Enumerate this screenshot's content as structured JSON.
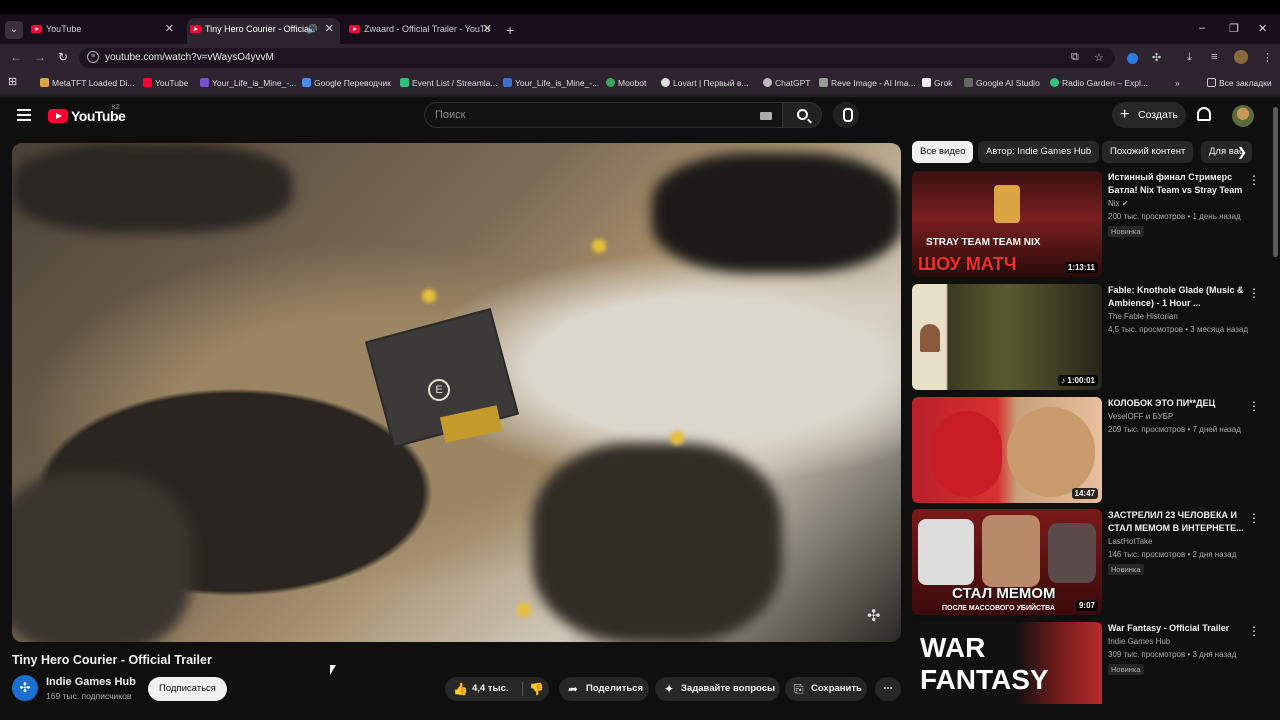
{
  "browser": {
    "tabs": [
      {
        "title": "YouTube"
      },
      {
        "title": "Tiny Hero Courier - Official"
      },
      {
        "title": "Zwaard - Official Trailer - YouTu"
      }
    ],
    "url": "youtube.com/watch?v=vWaysO4yvvM",
    "bookmarks": [
      "MetaTFT Loaded Di...",
      "YouTube",
      "Your_Life_is_Mine_-...",
      "Google Переводчик",
      "Event List / Streamla...",
      "Your_Life_is_Mine_-...",
      "Moobot",
      "Lovart | Первый в...",
      "ChatGPT",
      "Reve Image - AI Ima...",
      "Grok",
      "Google AI Studio",
      "Radio Garden – Expl..."
    ],
    "all_bookmarks": "Все закладки"
  },
  "header": {
    "logo_text": "YouTube",
    "region": "KZ",
    "search_placeholder": "Поиск",
    "create_label": "Создать"
  },
  "video": {
    "title": "Tiny Hero Courier - Official Trailer",
    "channel": "Indie Games Hub",
    "subscribers": "169 тыс. подписчиков",
    "subscribe_label": "Подписаться",
    "likes": "4,4 тыс.",
    "share_label": "Поделиться",
    "ask_label": "Задавайте вопросы",
    "save_label": "Сохранить",
    "e_key": "E"
  },
  "chips": [
    "Все видео",
    "Автор: Indie Games Hub",
    "Похожий контент",
    "Для вас"
  ],
  "recommendations": [
    {
      "title": "Истинный финал Стримерс Батла! Nix Team vs Stray Team",
      "channel": "Nix",
      "meta": "200 тыс. просмотров • 1 день назад",
      "badge": "Новинка",
      "duration": "1:13:11",
      "thumb_text": "ШОУ МАТЧ",
      "thumb_sub": "STRAY TEAM   TEAM NIX"
    },
    {
      "title": "Fable: Knothole Glade (Music & Ambience) - 1 Hour ...",
      "channel": "The Fable Historian",
      "meta": "4,5 тыс. просмотров • 3 месяца назад",
      "badge": "",
      "duration": "♪ 1:00:01",
      "thumb_text": "",
      "thumb_sub": ""
    },
    {
      "title": "КОЛОБОК ЭТО ПИ**ДЕЦ",
      "channel": "VeselOFF и БУБР",
      "meta": "209 тыс. просмотров • 7 дней назад",
      "badge": "",
      "duration": "14:47",
      "thumb_text": "",
      "thumb_sub": ""
    },
    {
      "title": "ЗАСТРЕЛИЛ 23 ЧЕЛОВЕКА И СТАЛ МЕМОМ В ИНТЕРНЕТЕ...",
      "channel": "LastHotTake",
      "meta": "146 тыс. просмотров • 2 дня назад",
      "badge": "Новинка",
      "duration": "9:07",
      "thumb_text": "СТАЛ МЕМОМ",
      "thumb_sub": "ПОСЛЕ МАССОВОГО УБИЙСТВА"
    },
    {
      "title": "War Fantasy - Official Trailer",
      "channel": "Indie Games Hub",
      "meta": "309 тыс. просмотров • 3 дня назад",
      "badge": "Новинка",
      "duration": "",
      "thumb_text": "WAR FANTASY",
      "thumb_sub": ""
    }
  ],
  "colors": {
    "brand_red": "#ff0033",
    "background": "#0f0f0f",
    "chip_bg": "#272727"
  }
}
